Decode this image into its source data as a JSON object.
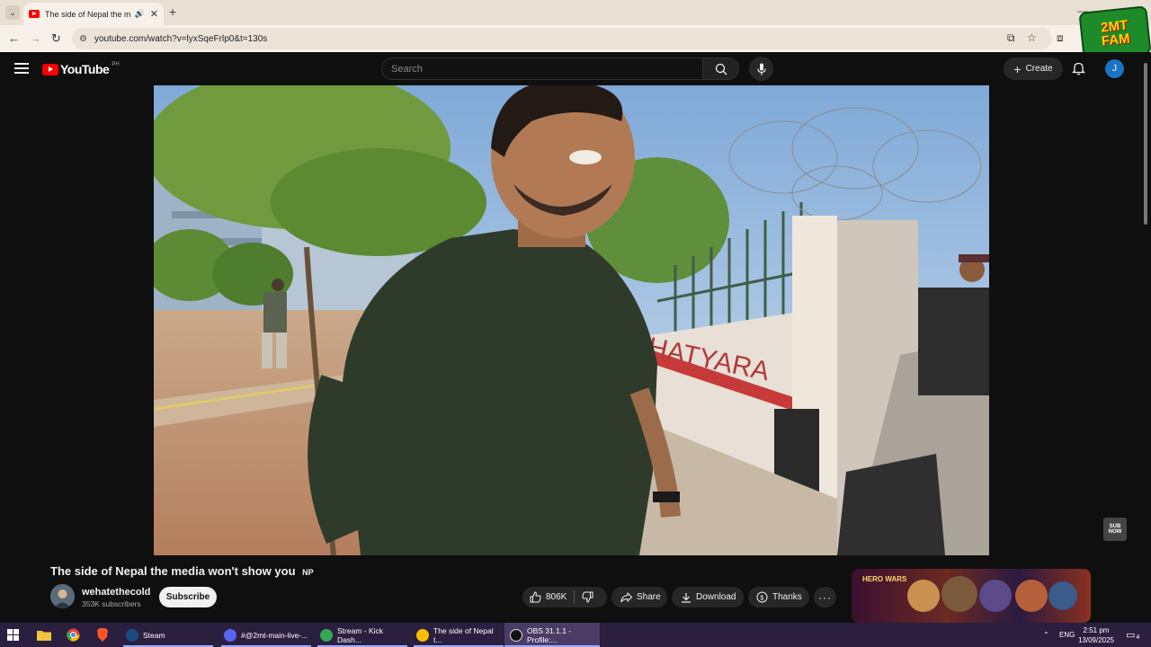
{
  "browser": {
    "tab_title": "The side of Nepal the media won't show you",
    "url": "youtube.com/watch?v=lyxSqeFrlp0&t=130s",
    "sticker_text": [
      "2MT",
      "FAM"
    ]
  },
  "youtube": {
    "logo_text": "YouTube",
    "region": "PH",
    "search_placeholder": "Search",
    "create_label": "Create",
    "avatar_letter": "J"
  },
  "video": {
    "title": "The side of Nepal the media won't show you 🇳🇵",
    "title_text": "The side of Nepal the media won't show you",
    "flag": "NP",
    "wall_text": "HATYARA",
    "badge": "SUB NOW"
  },
  "channel": {
    "name": "wehatethecold",
    "subscribers": "353K subscribers",
    "subscribe_label": "Subscribe"
  },
  "actions": {
    "likes": "806K",
    "share": "Share",
    "download": "Download",
    "thanks": "Thanks"
  },
  "ad": {
    "brand": "HERO WARS"
  },
  "taskbar": {
    "items": [
      {
        "label": "Steam"
      },
      {
        "label": "#@2mt-main-live-..."
      },
      {
        "label": "Stream - Kick Dash..."
      },
      {
        "label": "The side of Nepal t..."
      },
      {
        "label": "OBS 31.1.1 - Profile:..."
      }
    ],
    "lang": "ENG",
    "time": "2:51 pm",
    "date": "13/09/2025",
    "notifications": "4"
  },
  "colors": {
    "yt_red": "#ff0000",
    "background": "#0f0f0f",
    "taskbar": "#2a1f3f"
  }
}
